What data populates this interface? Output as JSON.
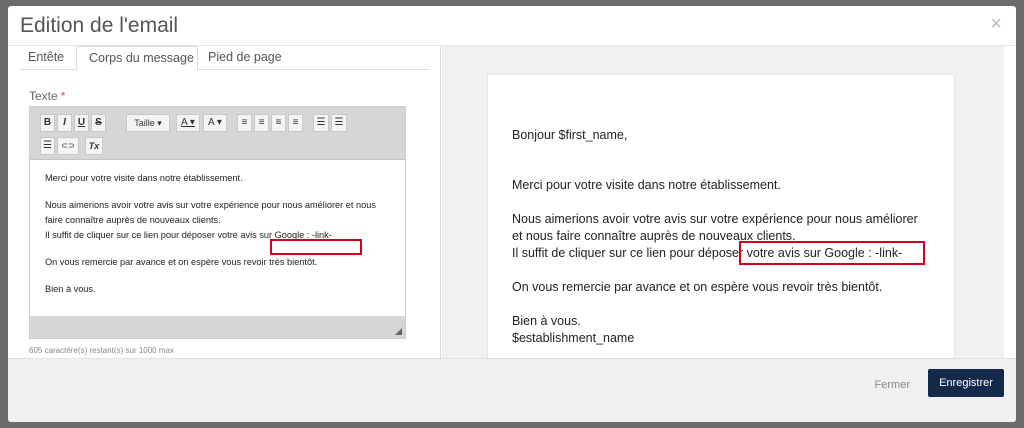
{
  "modal": {
    "title": "Edition de l'email",
    "close_icon": "×"
  },
  "tabs": [
    "Entête",
    "Corps du message",
    "Pied de page"
  ],
  "editor": {
    "label": "Texte",
    "required_mark": "*",
    "toolbar": {
      "bold": "B",
      "italic": "I",
      "underline": "U",
      "strike": "S",
      "size": "Taille ▾",
      "font_color": "A ▾",
      "bg_color": "A ▾",
      "align_left": "≡",
      "align_center": "≡",
      "align_right": "≡",
      "justify": "≡",
      "bullet_list": "☰",
      "ordered_list": "☰",
      "line_height": "☰",
      "link": "⊂⊃",
      "clear_format": "Tx"
    },
    "body": {
      "p1": "Merci pour votre visite dans notre établissement.",
      "p2a": "Nous aimerions avoir votre avis sur votre expérience pour nous améliorer et nous faire connaître auprès de nouveaux clients.",
      "p2b": "Il suffit de cliquer sur ce lien pour déposer votre avis sur Google : -link-",
      "p3": "On vous remercie par avance et on espère vous revoir très bientôt.",
      "p4": "Bien à vous."
    },
    "char_count": "605 caractère(s) restant(s) sur 1000 max"
  },
  "preview": {
    "greeting": "Bonjour $first_name,",
    "p1": "Merci pour votre visite dans notre établissement.",
    "p2a": "Nous aimerions avoir votre avis sur votre expérience pour nous améliorer et nous faire connaître auprès de nouveaux clients.",
    "p2b": "Il suffit de cliquer sur ce lien pour déposer votre avis sur Google : -link-",
    "p3": "On vous remercie par avance et on espère vous revoir très bientôt.",
    "p4": "Bien à vous.",
    "p5": "$establishment_name"
  },
  "footer": {
    "close_label": "Fermer",
    "save_label": "Enregistrer"
  },
  "colors": {
    "primary": "#132a4a",
    "highlight": "#d0021b",
    "required": "#d9534f"
  }
}
